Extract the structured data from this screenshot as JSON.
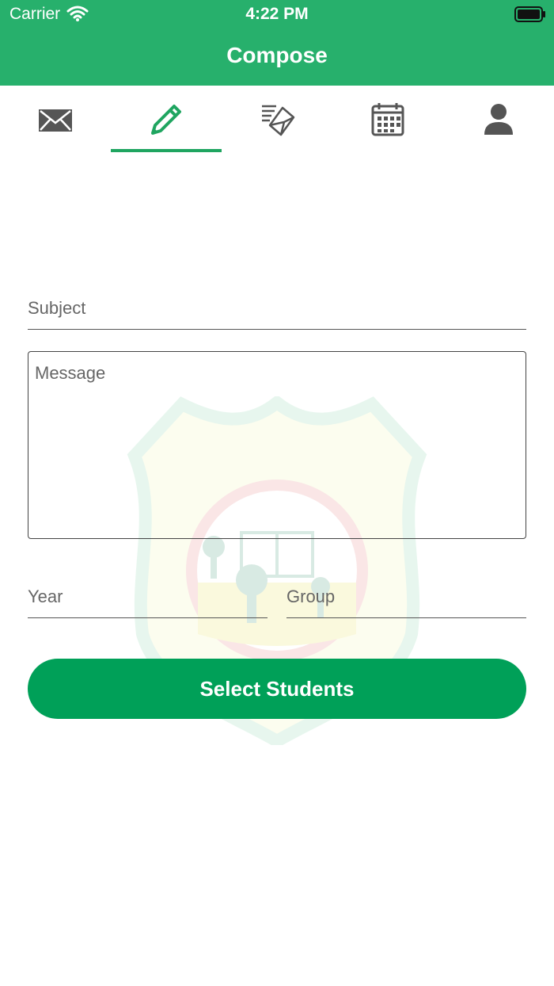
{
  "status_bar": {
    "carrier": "Carrier",
    "time": "4:22 PM"
  },
  "header": {
    "title": "Compose"
  },
  "tabs": [
    {
      "icon": "mail-icon",
      "selected": false
    },
    {
      "icon": "pencil-icon",
      "selected": true
    },
    {
      "icon": "sent-mail-icon",
      "selected": false
    },
    {
      "icon": "calendar-icon",
      "selected": false
    },
    {
      "icon": "person-icon",
      "selected": false
    }
  ],
  "form": {
    "subject_placeholder": "Subject",
    "message_placeholder": "Message",
    "year_placeholder": "Year",
    "group_placeholder": "Group",
    "submit_label": "Select Students"
  },
  "colors": {
    "header": "#27b06c",
    "accent": "#1fa560",
    "button": "#00a058"
  }
}
